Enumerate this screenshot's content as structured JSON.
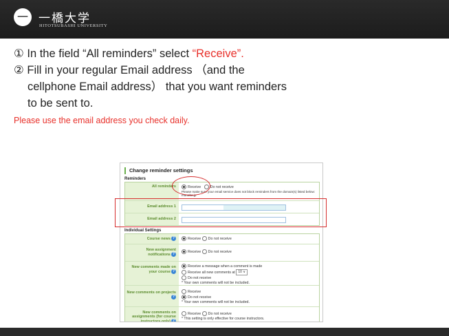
{
  "header": {
    "seal": "一",
    "name_jp": "一橋大学",
    "name_en": "HITOTSUBASHI UNIVERSITY"
  },
  "instructions": {
    "step1_prefix": "① In the field “All reminders” select ",
    "step1_highlight": "“Receive”.",
    "step2_line1": "② Fill in your regular Email address （and the",
    "step2_line2": "cellphone Email address） that you want reminders",
    "step2_line3": "to be sent to.",
    "note": "Please use the email address you check daily."
  },
  "screenshot": {
    "title": "Change reminder settings",
    "reminders_section": "Reminders",
    "all_reminders_label": "All reminders",
    "receive": "Receive",
    "do_not_receive": "Do not receive",
    "all_reminders_note": "Please make sure your email service does not block reminders from the domain(s) listed below: manaba.jp",
    "email1_label": "Email address 1",
    "email2_label": "Email address 2",
    "individual_section": "Individual Settings",
    "course_news_label": "Course news",
    "new_assignment_label": "New assignment notifications",
    "new_comments_course_label": "New comments made on your course",
    "comment_opt1": "Receive a message when a comment is made",
    "comment_opt2": "Receive all new comments at",
    "comment_opt2_value": "10",
    "comment_opt3": "Do not receive",
    "own_comments_note": "* Your own comments will not be included.",
    "new_comments_projects_label": "New comments on projects",
    "new_comments_assign_label": "New comments on assignments (for course instructors only)",
    "instructor_note": "* This setting is only effective for course instructors."
  },
  "colors": {
    "highlight_red": "#e8302a",
    "label_green": "#5a8b2c",
    "header_dark": "#1c1c1c"
  }
}
